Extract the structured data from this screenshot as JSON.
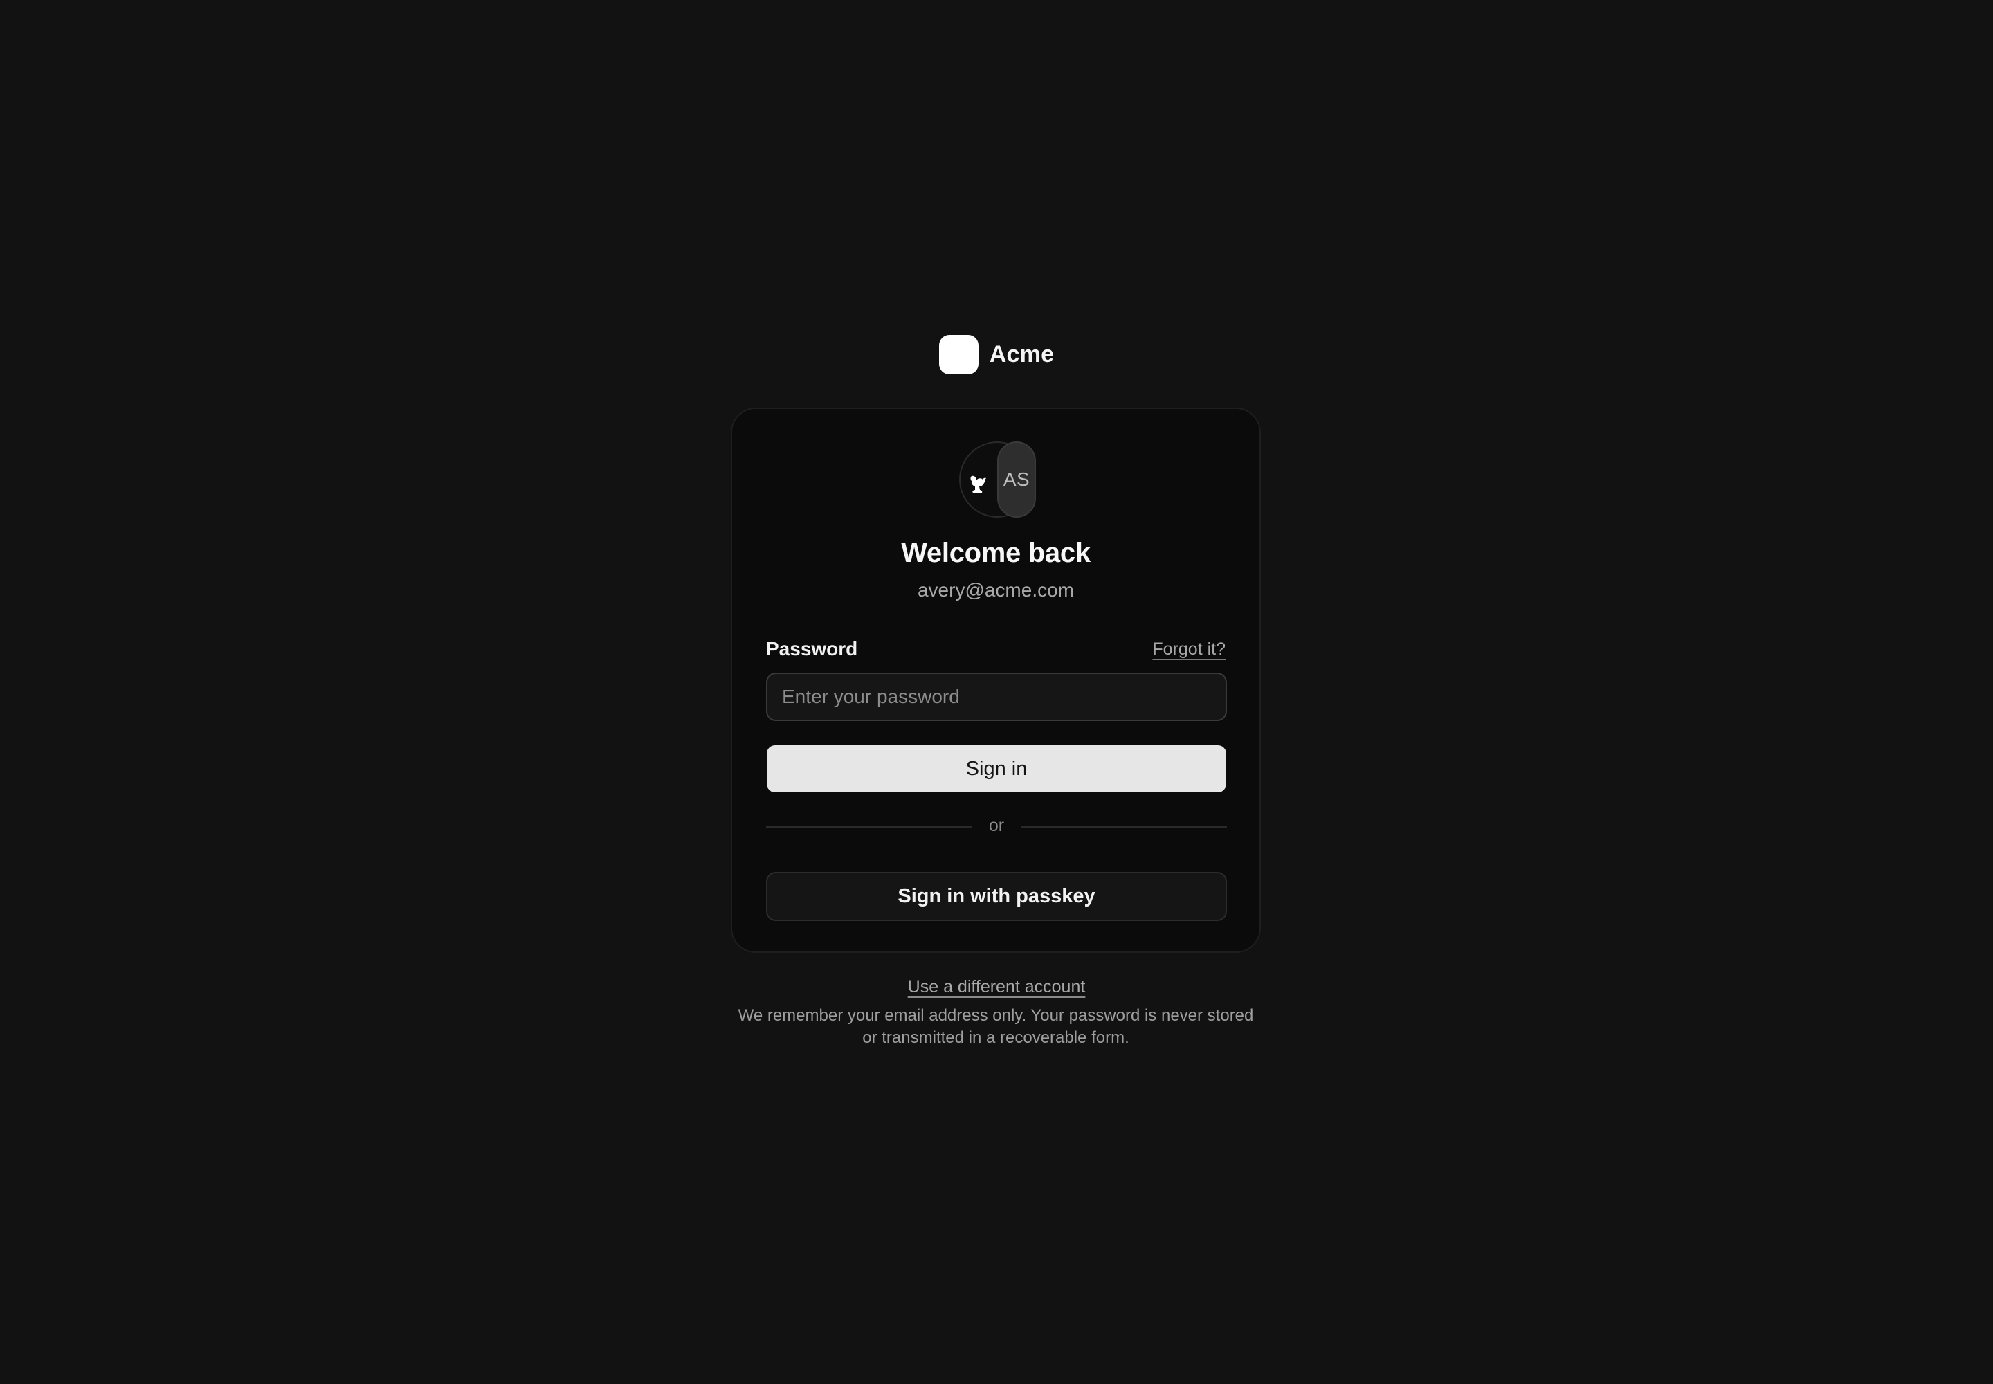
{
  "brand": {
    "name": "Acme",
    "logo_color": "#ffffff"
  },
  "account": {
    "avatar_org_icon": "squirrel-icon",
    "avatar_initials": "AS",
    "welcome_title": "Welcome back",
    "email": "avery@acme.com"
  },
  "form": {
    "password_label": "Password",
    "forgot_link": "Forgot it?",
    "password_placeholder": "Enter your password",
    "password_value": "",
    "signin_label": "Sign in",
    "divider_text": "or",
    "passkey_label": "Sign in with passkey"
  },
  "footer": {
    "different_account_link": "Use a different account",
    "note": "We remember your email address only. Your password is never stored or transmitted in a recoverable form."
  },
  "colors": {
    "background": "#121212",
    "card": "#0b0b0b",
    "primary_button": "#e6e6e6",
    "text_primary": "#f5f5f5",
    "text_muted": "#a8a8a8"
  }
}
